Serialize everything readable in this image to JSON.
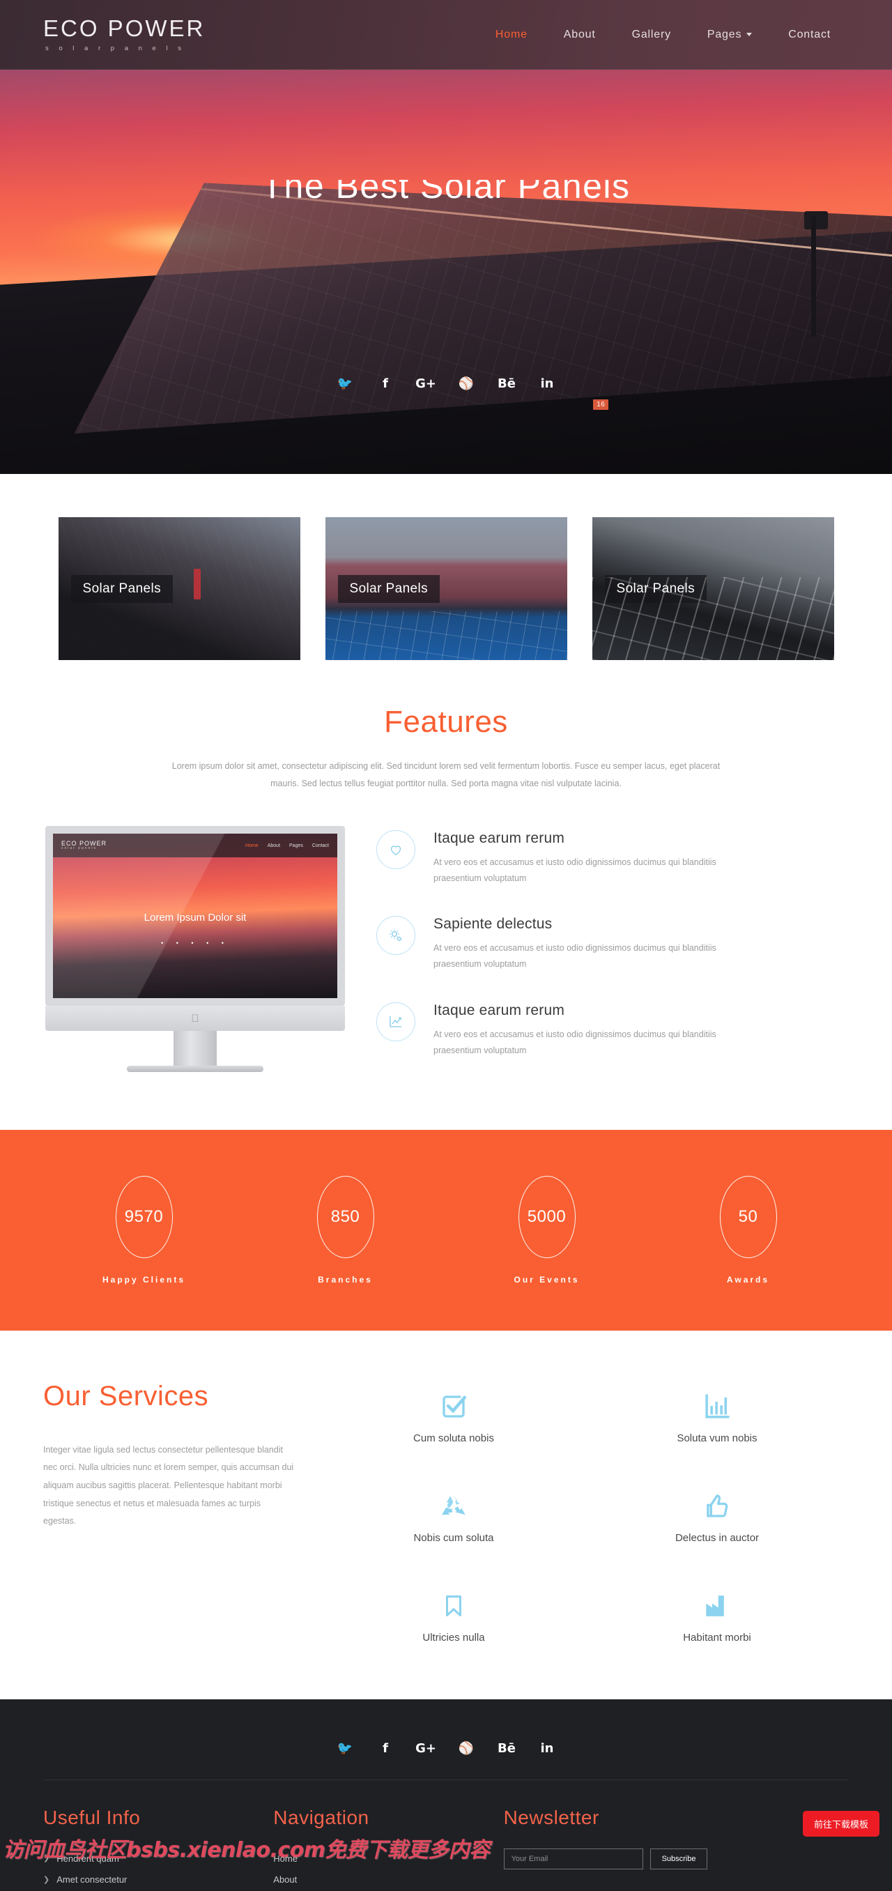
{
  "header": {
    "brand_title": "ECO POWER",
    "brand_sub": "s o l a r   p a n e l s",
    "nav": [
      {
        "label": "Home",
        "active": true
      },
      {
        "label": "About",
        "active": false
      },
      {
        "label": "Gallery",
        "active": false
      },
      {
        "label": "Pages",
        "active": false,
        "caret": true
      },
      {
        "label": "Contact",
        "active": false
      }
    ]
  },
  "hero": {
    "title": "The Best Solar Panels",
    "marker": "16",
    "social": [
      "twitter",
      "facebook",
      "google-plus",
      "dribbble",
      "behance",
      "linkedin"
    ],
    "social_glyphs": [
      "🐦",
      "f",
      "G+",
      "⚾",
      "Bē",
      "in"
    ]
  },
  "thumbnails": [
    {
      "caption": "Solar Panels"
    },
    {
      "caption": "Solar Panels"
    },
    {
      "caption": "Solar Panels"
    }
  ],
  "features": {
    "title": "Features",
    "lead": "Lorem ipsum dolor sit amet, consectetur adipiscing elit. Sed tincidunt lorem sed velit fermentum lobortis. Fusce eu semper lacus, eget placerat mauris. Sed lectus tellus feugiat porttitor nulla. Sed porta magna vitae nisl vulputate lacinia.",
    "mockup": {
      "brand": "ECO POWER",
      "brand_sub": "solar panels",
      "links": [
        "Home",
        "About",
        "Pages",
        "Contact"
      ],
      "title": "Lorem Ipsum Dolor sit",
      "dots": "• • • • •"
    },
    "items": [
      {
        "icon": "heart-icon",
        "title": "Itaque earum rerum",
        "text": "At vero eos et accusamus et iusto odio dignissimos ducimus qui blanditiis praesentium voluptatum"
      },
      {
        "icon": "gears-icon",
        "title": "Sapiente delectus",
        "text": "At vero eos et accusamus et iusto odio dignissimos ducimus qui blanditiis praesentium voluptatum"
      },
      {
        "icon": "line-chart-icon",
        "title": "Itaque earum rerum",
        "text": "At vero eos et accusamus et iusto odio dignissimos ducimus qui blanditiis praesentium voluptatum"
      }
    ]
  },
  "counters": [
    {
      "value": "9570",
      "label": "Happy Clients"
    },
    {
      "value": "850",
      "label": "Branches"
    },
    {
      "value": "5000",
      "label": "Our Events"
    },
    {
      "value": "50",
      "label": "Awards"
    }
  ],
  "services": {
    "title": "Our Services",
    "text": "Integer vitae ligula sed lectus consectetur pellentesque blandit nec orci. Nulla ultricies nunc et lorem semper, quis accumsan dui aliquam aucibus sagittis placerat. Pellentesque habitant morbi tristique senectus et netus et malesuada fames ac turpis egestas.",
    "items": [
      {
        "icon": "check-square-icon",
        "label": "Cum soluta nobis"
      },
      {
        "icon": "bar-chart-icon",
        "label": "Soluta vum nobis"
      },
      {
        "icon": "recycle-icon",
        "label": "Nobis cum soluta"
      },
      {
        "icon": "thumbs-up-icon",
        "label": "Delectus in auctor"
      },
      {
        "icon": "bookmark-icon",
        "label": "Ultricies nulla"
      },
      {
        "icon": "factory-icon",
        "label": "Habitant morbi"
      }
    ]
  },
  "footer": {
    "social_glyphs": [
      "🐦",
      "f",
      "G+",
      "⚾",
      "Bē",
      "in"
    ],
    "useful_info": {
      "title": "Useful Info",
      "items": [
        "Hendrerit quam",
        "Amet consectetur"
      ]
    },
    "navigation": {
      "title": "Navigation",
      "items": [
        "Home",
        "About"
      ]
    },
    "newsletter": {
      "title": "Newsletter",
      "email_placeholder": "Your Email",
      "email_value": "",
      "subscribe_label": "Subscribe"
    },
    "download_button": "前往下载模板",
    "watermark": "访问血鸟社区bsbs.xienlao.com免费下载更多内容"
  },
  "colors": {
    "accent_orange": "#f95f32",
    "counter_bg": "#f95f32",
    "service_icon": "#8bd3ef",
    "footer_bg": "#1f2024",
    "download_red": "#ed1c24"
  }
}
